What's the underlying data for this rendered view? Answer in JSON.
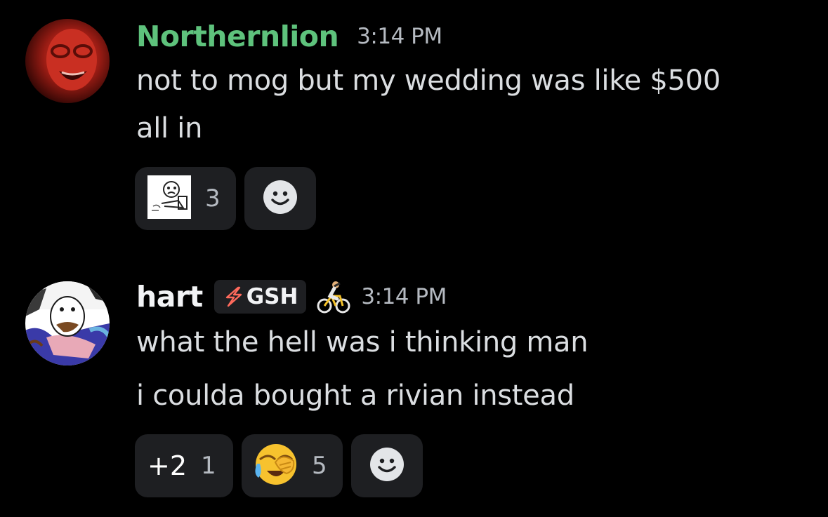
{
  "messages": [
    {
      "username": "Northernlion",
      "username_color": "#5ec27c",
      "timestamp": "3:14 PM",
      "lines": [
        "not to mog but my wedding was like $500",
        "all in"
      ],
      "reactions": [
        {
          "emoji": "rage-comic-meme-icon",
          "count": "3"
        },
        {
          "emoji": "add-reaction-icon",
          "count": null
        }
      ]
    },
    {
      "username": "hart",
      "username_color": "#f2f3f5",
      "guild_tag": "GSH",
      "status_emoji": "person-biking-emoji",
      "timestamp": "3:14 PM",
      "lines": [
        "what the hell was i thinking man",
        "i coulda bought a rivian instead"
      ],
      "reactions": [
        {
          "emoji": "+2",
          "count": "1"
        },
        {
          "emoji": "face-holding-back-tears-emoji",
          "count": "5"
        },
        {
          "emoji": "add-reaction-icon",
          "count": null
        }
      ]
    }
  ],
  "colors": {
    "background": "#000000",
    "reaction_bg": "#1e1f22",
    "text": "#dbdee1",
    "muted": "#b5bac1",
    "green_name": "#5ec27c"
  }
}
